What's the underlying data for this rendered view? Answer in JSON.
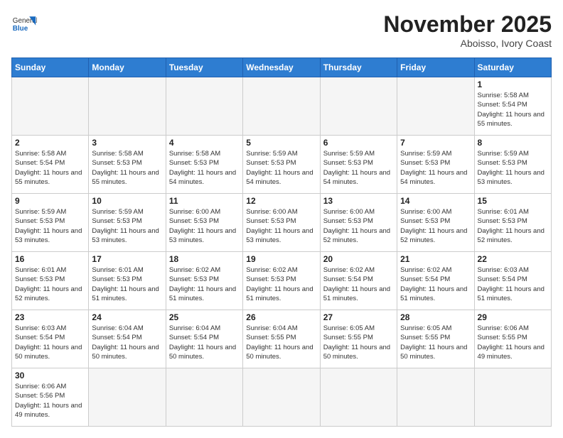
{
  "header": {
    "title": "November 2025",
    "location": "Aboisso, Ivory Coast",
    "logo_general": "General",
    "logo_blue": "Blue"
  },
  "days_of_week": [
    "Sunday",
    "Monday",
    "Tuesday",
    "Wednesday",
    "Thursday",
    "Friday",
    "Saturday"
  ],
  "weeks": [
    [
      {
        "day": "",
        "empty": true
      },
      {
        "day": "",
        "empty": true
      },
      {
        "day": "",
        "empty": true
      },
      {
        "day": "",
        "empty": true
      },
      {
        "day": "",
        "empty": true
      },
      {
        "day": "",
        "empty": true
      },
      {
        "day": "1",
        "sunrise": "5:58 AM",
        "sunset": "5:54 PM",
        "daylight": "11 hours and 55 minutes."
      }
    ],
    [
      {
        "day": "2",
        "sunrise": "5:58 AM",
        "sunset": "5:54 PM",
        "daylight": "11 hours and 55 minutes."
      },
      {
        "day": "3",
        "sunrise": "5:58 AM",
        "sunset": "5:53 PM",
        "daylight": "11 hours and 55 minutes."
      },
      {
        "day": "4",
        "sunrise": "5:58 AM",
        "sunset": "5:53 PM",
        "daylight": "11 hours and 54 minutes."
      },
      {
        "day": "5",
        "sunrise": "5:59 AM",
        "sunset": "5:53 PM",
        "daylight": "11 hours and 54 minutes."
      },
      {
        "day": "6",
        "sunrise": "5:59 AM",
        "sunset": "5:53 PM",
        "daylight": "11 hours and 54 minutes."
      },
      {
        "day": "7",
        "sunrise": "5:59 AM",
        "sunset": "5:53 PM",
        "daylight": "11 hours and 54 minutes."
      },
      {
        "day": "8",
        "sunrise": "5:59 AM",
        "sunset": "5:53 PM",
        "daylight": "11 hours and 53 minutes."
      }
    ],
    [
      {
        "day": "9",
        "sunrise": "5:59 AM",
        "sunset": "5:53 PM",
        "daylight": "11 hours and 53 minutes."
      },
      {
        "day": "10",
        "sunrise": "5:59 AM",
        "sunset": "5:53 PM",
        "daylight": "11 hours and 53 minutes."
      },
      {
        "day": "11",
        "sunrise": "6:00 AM",
        "sunset": "5:53 PM",
        "daylight": "11 hours and 53 minutes."
      },
      {
        "day": "12",
        "sunrise": "6:00 AM",
        "sunset": "5:53 PM",
        "daylight": "11 hours and 53 minutes."
      },
      {
        "day": "13",
        "sunrise": "6:00 AM",
        "sunset": "5:53 PM",
        "daylight": "11 hours and 52 minutes."
      },
      {
        "day": "14",
        "sunrise": "6:00 AM",
        "sunset": "5:53 PM",
        "daylight": "11 hours and 52 minutes."
      },
      {
        "day": "15",
        "sunrise": "6:01 AM",
        "sunset": "5:53 PM",
        "daylight": "11 hours and 52 minutes."
      }
    ],
    [
      {
        "day": "16",
        "sunrise": "6:01 AM",
        "sunset": "5:53 PM",
        "daylight": "11 hours and 52 minutes."
      },
      {
        "day": "17",
        "sunrise": "6:01 AM",
        "sunset": "5:53 PM",
        "daylight": "11 hours and 51 minutes."
      },
      {
        "day": "18",
        "sunrise": "6:02 AM",
        "sunset": "5:53 PM",
        "daylight": "11 hours and 51 minutes."
      },
      {
        "day": "19",
        "sunrise": "6:02 AM",
        "sunset": "5:53 PM",
        "daylight": "11 hours and 51 minutes."
      },
      {
        "day": "20",
        "sunrise": "6:02 AM",
        "sunset": "5:54 PM",
        "daylight": "11 hours and 51 minutes."
      },
      {
        "day": "21",
        "sunrise": "6:02 AM",
        "sunset": "5:54 PM",
        "daylight": "11 hours and 51 minutes."
      },
      {
        "day": "22",
        "sunrise": "6:03 AM",
        "sunset": "5:54 PM",
        "daylight": "11 hours and 51 minutes."
      }
    ],
    [
      {
        "day": "23",
        "sunrise": "6:03 AM",
        "sunset": "5:54 PM",
        "daylight": "11 hours and 50 minutes."
      },
      {
        "day": "24",
        "sunrise": "6:04 AM",
        "sunset": "5:54 PM",
        "daylight": "11 hours and 50 minutes."
      },
      {
        "day": "25",
        "sunrise": "6:04 AM",
        "sunset": "5:54 PM",
        "daylight": "11 hours and 50 minutes."
      },
      {
        "day": "26",
        "sunrise": "6:04 AM",
        "sunset": "5:55 PM",
        "daylight": "11 hours and 50 minutes."
      },
      {
        "day": "27",
        "sunrise": "6:05 AM",
        "sunset": "5:55 PM",
        "daylight": "11 hours and 50 minutes."
      },
      {
        "day": "28",
        "sunrise": "6:05 AM",
        "sunset": "5:55 PM",
        "daylight": "11 hours and 50 minutes."
      },
      {
        "day": "29",
        "sunrise": "6:06 AM",
        "sunset": "5:55 PM",
        "daylight": "11 hours and 49 minutes."
      }
    ],
    [
      {
        "day": "30",
        "sunrise": "6:06 AM",
        "sunset": "5:56 PM",
        "daylight": "11 hours and 49 minutes."
      },
      {
        "day": "",
        "empty": true
      },
      {
        "day": "",
        "empty": true
      },
      {
        "day": "",
        "empty": true
      },
      {
        "day": "",
        "empty": true
      },
      {
        "day": "",
        "empty": true
      },
      {
        "day": "",
        "empty": true
      }
    ]
  ],
  "labels": {
    "sunrise": "Sunrise:",
    "sunset": "Sunset:",
    "daylight": "Daylight:"
  }
}
